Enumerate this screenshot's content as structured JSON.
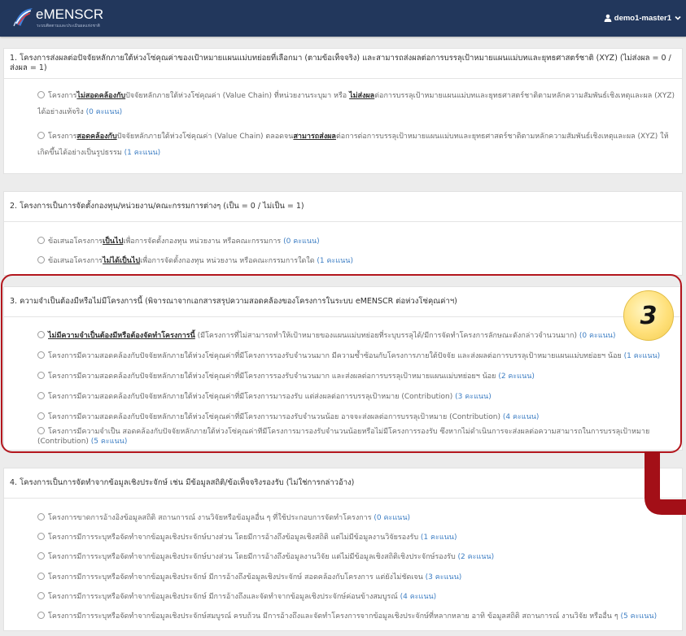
{
  "theme": {
    "header_bg": "#22375c",
    "highlight": "#b3161d",
    "badge": "#ffe07a",
    "score": "#3f7fc4",
    "connector": "#a30f17"
  },
  "header": {
    "app_name": "eMENSCR",
    "app_tagline": "ระบบติดตามและประเมินผลแห่งชาติ",
    "logo_icon": "emenscr-logo",
    "user_icon": "user-icon",
    "user_name": "demo1-master1",
    "menu_icon": "chevron-down-icon"
  },
  "sections": [
    {
      "title": "1. โครงการส่งผลต่อปัจจัยหลักภายใต้ห่วงโซ่คุณค่าของเป้าหมายแผนแม่บทย่อยที่เลือกมา (ตามข้อเท็จจริง) และสามารถส่งผลต่อการบรรลุเป้าหมายแผนแม่บทและยุทธศาสตร์ชาติ (XYZ) (ไม่ส่งผล = 0 / ส่งผล = 1)",
      "options": [
        {
          "checked": false,
          "segments": [
            {
              "text": "โครงการ",
              "emphasis": false
            },
            {
              "text": "ไม่สอดคล้องกับ",
              "emphasis": true
            },
            {
              "text": "ปัจจัยหลักภายใต้ห่วงโซ่คุณค่า (Value Chain) ที่หน่วยงานระบุมา หรือ ",
              "emphasis": false
            },
            {
              "text": "ไม่ส่งผล",
              "emphasis": true
            },
            {
              "text": "ต่อการบรรลุเป้าหมายแผนแม่บทและยุทธศาสตร์ชาติตามหลักความสัมพันธ์เชิงเหตุและผล (XYZ) ได้อย่างแท้จริง ",
              "emphasis": false
            }
          ],
          "score": "(0 คะแนน)"
        },
        {
          "checked": false,
          "segments": [
            {
              "text": "โครงการ",
              "emphasis": false
            },
            {
              "text": "สอดคล้องกับ",
              "emphasis": true
            },
            {
              "text": "ปัจจัยหลักภายใต้ห่วงโซ่คุณค่า (Value Chain) ตลอดจน",
              "emphasis": false
            },
            {
              "text": "สามารถส่งผล",
              "emphasis": true
            },
            {
              "text": "ต่อการต่อการบรรลุเป้าหมายแผนแม่บทและยุทธศาสตร์ชาติตามหลักความสัมพันธ์เชิงเหตุและผล (XYZ) ให้เกิดขึ้นได้อย่างเป็นรูปธรรม ",
              "emphasis": false
            }
          ],
          "score": "(1 คะแนน)"
        }
      ]
    },
    {
      "title": "2. โครงการเป็นการจัดตั้งกองทุน/หน่วยงาน/คณะกรรมการต่างๆ (เป็น = 0 / ไม่เป็น = 1)",
      "options": [
        {
          "checked": false,
          "segments": [
            {
              "text": "ข้อเสนอโครงการ",
              "emphasis": false
            },
            {
              "text": "เป็นไป",
              "emphasis": true
            },
            {
              "text": "เพื่อการจัดตั้งกองทุน หน่วยงาน หรือคณะกรรมการ ",
              "emphasis": false
            }
          ],
          "score": "(0 คะแนน)"
        },
        {
          "checked": false,
          "segments": [
            {
              "text": "ข้อเสนอโครงการ",
              "emphasis": false
            },
            {
              "text": "ไม่ได้เป็นไป",
              "emphasis": true
            },
            {
              "text": "เพื่อการจัดตั้งกองทุน หน่วยงาน หรือคณะกรรมการใดใด ",
              "emphasis": false
            }
          ],
          "score": "(1 คะแนน)"
        }
      ]
    },
    {
      "title": "3. ความจำเป็นต้องมีหรือไม่มีโครงการนี้ (พิจารณาจากเอกสารสรุปความสอดคล้องของโครงการในระบบ eMENSCR ต่อห่วงโซ่คุณค่าฯ)",
      "options": [
        {
          "checked": false,
          "segments": [
            {
              "text": "ไม่มีความจำเป็นต้องมีหรือต้องจัดทำโครงการนี้",
              "emphasis": true
            },
            {
              "text": " (มีโครงการที่ไม่สามารถทำให้เป้าหมายของแผนแม่บทย่อยที่ระบุบรรลุได้/มีการจัดทำโครงการลักษณะดังกล่าวจำนวนมาก) ",
              "emphasis": false
            }
          ],
          "score": "(0 คะแนน)"
        },
        {
          "checked": false,
          "segments": [
            {
              "text": "โครงการมีความสอดคล้องกับปัจจัยหลักภายใต้ห่วงโซ่คุณค่าที่มีโครงการรองรับจำนวนมาก มีความซ้ำซ้อนกับโครงการภายใต้ปัจจัย และส่งผลต่อการบรรลุเป้าหมายแผนแม่บทย่อยฯ น้อย ",
              "emphasis": false
            }
          ],
          "score": "(1 คะแนน)"
        },
        {
          "checked": false,
          "segments": [
            {
              "text": "โครงการมีความสอดคล้องกับปัจจัยหลักภายใต้ห่วงโซ่คุณค่าที่มีโครงการรองรับจำนวนมาก และส่งผลต่อการบรรลุเป้าหมายแผนแม่บทย่อยฯ น้อย ",
              "emphasis": false
            }
          ],
          "score": "(2 คะแนน)"
        },
        {
          "checked": false,
          "segments": [
            {
              "text": "โครงการมีความสอดคล้องกับปัจจัยหลักภายใต้ห่วงโซ่คุณค่าที่มีโครงการมารองรับ แต่ส่งผลต่อการบรรลุเป้าหมาย (Contribution) ",
              "emphasis": false
            }
          ],
          "score": "(3 คะแนน)"
        },
        {
          "checked": false,
          "segments": [
            {
              "text": "โครงการมีความสอดคล้องกับปัจจัยหลักภายใต้ห่วงโซ่คุณค่าที่มีโครงการมารองรับจำนวนน้อย อาจจะส่งผลต่อการบรรลุเป้าหมาย (Contribution) ",
              "emphasis": false
            }
          ],
          "score": "(4 คะแนน)"
        },
        {
          "checked": false,
          "segments": [
            {
              "text": "โครงการมีความจำเป็น สอดคล้องกับปัจจัยหลักภายใต้ห่วงโซ่คุณค่าที่มีโครงการมารองรับจำนวนน้อยหรือไม่มีโครงการรองรับ ซึ่งหากไม่ดำเนินการจะส่งผลต่อความสามารถในการบรรลุเป้าหมาย (Contribution) ",
              "emphasis": false
            }
          ],
          "score": "(5 คะแนน)"
        }
      ]
    },
    {
      "title": "4. โครงการเป็นการจัดทำจากข้อมูลเชิงประจักษ์ เช่น มีข้อมูลสถิติ/ข้อเท็จจริงรองรับ (ไม่ใช่การกล่าวอ้าง)",
      "options": [
        {
          "checked": false,
          "segments": [
            {
              "text": "โครงการขาดการอ้างอิงข้อมูลสถิติ สถานการณ์ งานวิจัยหรือข้อมูลอื่น ๆ ที่ใช้ประกอบการจัดทำโครงการ ",
              "emphasis": false
            }
          ],
          "score": "(0 คะแนน)"
        },
        {
          "checked": false,
          "segments": [
            {
              "text": "โครงการมีการระบุหรือจัดทำจากข้อมูลเชิงประจักษ์บางส่วน โดยมีการอ้างถึงข้อมูลเชิงสถิติ แต่ไม่มีข้อมูลงานวิจัยรองรับ ",
              "emphasis": false
            }
          ],
          "score": "(1 คะแนน)"
        },
        {
          "checked": false,
          "segments": [
            {
              "text": "โครงการมีการระบุหรือจัดทำจากข้อมูลเชิงประจักษ์บางส่วน โดยมีการอ้างถึงข้อมูลงานวิจัย แต่ไม่มีข้อมูลเชิงสถิติเชิงประจักษ์รองรับ ",
              "emphasis": false
            }
          ],
          "score": "(2 คะแนน)"
        },
        {
          "checked": false,
          "segments": [
            {
              "text": "โครงการมีการระบุหรือจัดทำจากข้อมูลเชิงประจักษ์ มีการอ้างถึงข้อมูลเชิงประจักษ์ สอดคล้องกับโครงการ แต่ยังไม่ชัดเจน ",
              "emphasis": false
            }
          ],
          "score": "(3 คะแนน)"
        },
        {
          "checked": false,
          "segments": [
            {
              "text": "โครงการมีการระบุหรือจัดทำจากข้อมูลเชิงประจักษ์ มีการอ้างถึงและจัดทำจากข้อมูลเชิงประจักษ์ค่อนข้างสมบูรณ์ ",
              "emphasis": false
            }
          ],
          "score": "(4 คะแนน)"
        },
        {
          "checked": false,
          "segments": [
            {
              "text": "โครงการมีการระบุหรือจัดทำจากข้อมูลเชิงประจักษ์สมบูรณ์ ครบถ้วน มีการอ้างถึงและจัดทำโครงการจากข้อมูลเชิงประจักษ์ที่หลากหลาย อาทิ ข้อมูลสถิติ สถานการณ์ งานวิจัย หรืออื่น ๆ ",
              "emphasis": false
            }
          ],
          "score": "(5 คะแนน)"
        }
      ]
    }
  ],
  "annotation": {
    "badge_label": "3",
    "badge_icon": "number-badge",
    "connector_icon": "l-shaped-connector"
  }
}
